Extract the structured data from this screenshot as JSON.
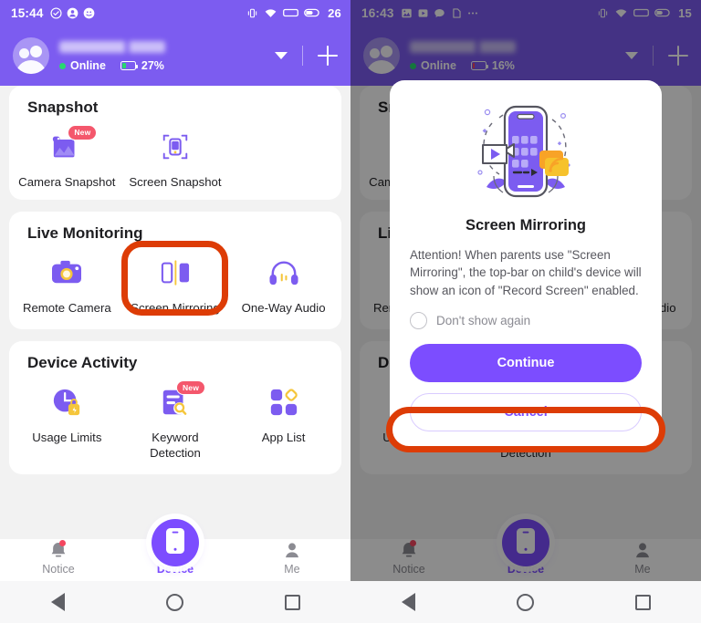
{
  "theme": {
    "brand_purple": "#7c5cf0",
    "brand_purple_dark": "#3c3080",
    "accent_orange": "#dd3c06",
    "badge_red": "#f4576c",
    "online_green": "#27d86f",
    "yellow": "#f5c63c"
  },
  "left": {
    "status": {
      "time": "15:44",
      "left_icons": [
        "check-circle-icon",
        "person-circle-icon",
        "clock-icon"
      ],
      "right_icons": [
        "vibrate-icon",
        "wifi-icon",
        "signal-icon"
      ],
      "battery": "26"
    },
    "header": {
      "device_name": "",
      "online_label": "Online",
      "battery_percent": "27%",
      "battery_level": 27,
      "caret_icon": "chevron-down-icon",
      "add_icon": "plus-icon"
    },
    "cards": [
      {
        "title": "Snapshot",
        "tiles": [
          {
            "label": "Camera Snapshot",
            "icon": "camera-snapshot-icon",
            "badge": "New"
          },
          {
            "label": "Screen Snapshot",
            "icon": "screen-snapshot-icon",
            "badge": ""
          }
        ]
      },
      {
        "title": "Live Monitoring",
        "tiles": [
          {
            "label": "Remote Camera",
            "icon": "remote-camera-icon",
            "badge": ""
          },
          {
            "label": "Screen Mirroring",
            "icon": "screen-mirroring-icon",
            "badge": ""
          },
          {
            "label": "One-Way Audio",
            "icon": "one-way-audio-icon",
            "badge": ""
          }
        ]
      },
      {
        "title": "Device Activity",
        "tiles": [
          {
            "label": "Usage Limits",
            "icon": "usage-limits-icon",
            "badge": ""
          },
          {
            "label": "Keyword\nDetection",
            "icon": "keyword-detection-icon",
            "badge": "New"
          },
          {
            "label": "App List",
            "icon": "app-list-icon",
            "badge": ""
          }
        ]
      }
    ],
    "nav": [
      {
        "label": "Notice",
        "icon": "bell-icon",
        "active": false,
        "has_dot": true
      },
      {
        "label": "Device",
        "icon": "phone-icon",
        "active": true,
        "has_dot": false
      },
      {
        "label": "Me",
        "icon": "person-icon",
        "active": false,
        "has_dot": false
      }
    ],
    "sysnav": [
      "back-icon",
      "home-icon",
      "recents-icon"
    ]
  },
  "right": {
    "status": {
      "time": "16:43",
      "left_icons": [
        "image-icon",
        "video-icon",
        "message-icon",
        "copy-icon",
        "more-icon"
      ],
      "right_icons": [
        "vibrate-icon",
        "wifi-icon",
        "signal-icon"
      ],
      "battery": "15"
    },
    "header": {
      "device_name": "",
      "online_label": "Online",
      "battery_percent": "16%",
      "battery_level": 16,
      "caret_icon": "chevron-down-icon",
      "add_icon": "plus-icon"
    },
    "dialog": {
      "art_icon": "screen-mirroring-illustration",
      "title": "Screen Mirroring",
      "body": "Attention! When parents use \"Screen Mirroring\", the top-bar on child's device will show an icon of \"Record Screen\" enabled.",
      "checkbox_label": "Don't show again",
      "primary_label": "Continue",
      "secondary_label": "Cancel"
    },
    "nav": [
      {
        "label": "Notice",
        "icon": "bell-icon",
        "active": false,
        "has_dot": true
      },
      {
        "label": "Device",
        "icon": "phone-icon",
        "active": true,
        "has_dot": false
      },
      {
        "label": "Me",
        "icon": "person-icon",
        "active": false,
        "has_dot": false
      }
    ],
    "sysnav": [
      "back-icon",
      "home-icon",
      "recents-icon"
    ]
  },
  "annotations": [
    {
      "name": "screen-mirroring-highlight",
      "target": "Screen Mirroring tile"
    },
    {
      "name": "continue-button-highlight",
      "target": "Continue button"
    }
  ]
}
